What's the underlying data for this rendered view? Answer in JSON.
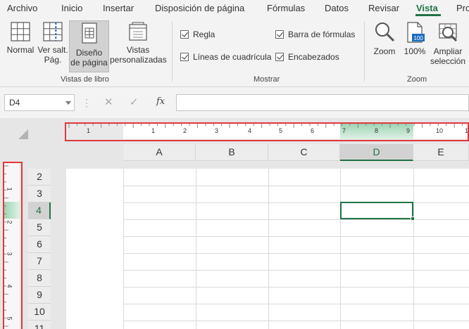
{
  "menu": {
    "tabs": [
      {
        "label": "Archivo"
      },
      {
        "label": "Inicio"
      },
      {
        "label": "Insertar"
      },
      {
        "label": "Disposición de página"
      },
      {
        "label": "Fórmulas"
      },
      {
        "label": "Datos"
      },
      {
        "label": "Revisar"
      },
      {
        "label": "Vista",
        "active": true
      },
      {
        "label": "Pro"
      }
    ]
  },
  "ribbon": {
    "workbook_views": {
      "group_label": "Vistas de libro",
      "buttons": [
        {
          "label_line1": "Normal",
          "label_line2": "",
          "icon": "normal-view-icon"
        },
        {
          "label_line1": "Ver salt.",
          "label_line2": "Pág.",
          "icon": "page-break-preview-icon"
        },
        {
          "label_line1": "Diseño",
          "label_line2": "de página",
          "icon": "page-layout-icon",
          "selected": true
        },
        {
          "label_line1": "Vistas",
          "label_line2": "personalizadas",
          "icon": "custom-views-icon"
        }
      ]
    },
    "show": {
      "group_label": "Mostrar",
      "checkboxes": [
        {
          "label": "Regla",
          "checked": true
        },
        {
          "label": "Líneas de cuadrícula",
          "checked": true
        },
        {
          "label": "Barra de fórmulas",
          "checked": true
        },
        {
          "label": "Encabezados",
          "checked": true
        }
      ]
    },
    "zoom": {
      "group_label": "Zoom",
      "buttons": [
        {
          "label_line1": "Zoom",
          "label_line2": "",
          "icon": "zoom-magnifier-icon"
        },
        {
          "label_line1": "100%",
          "label_line2": "",
          "icon": "zoom-100-icon",
          "icon_text": "100"
        },
        {
          "label_line1": "Ampliar",
          "label_line2": "selección",
          "icon": "zoom-to-selection-icon"
        }
      ]
    }
  },
  "formula_bar": {
    "name_box": "D4",
    "cancel_symbol": "✕",
    "enter_symbol": "✓",
    "fx_symbol": "fx",
    "value": ""
  },
  "ruler": {
    "horizontal_numbers": [
      "1",
      "1",
      "2",
      "3",
      "4",
      "5",
      "6",
      "7",
      "8",
      "9",
      "10",
      "1"
    ],
    "vertical_numbers": [
      "1",
      "2",
      "3",
      "4",
      "5"
    ]
  },
  "sheet": {
    "columns": [
      "A",
      "B",
      "C",
      "D",
      "E"
    ],
    "rows": [
      "2",
      "3",
      "4",
      "5",
      "6",
      "7",
      "8",
      "9",
      "10",
      "11"
    ],
    "selected_cell": "D4",
    "selected_column": "D",
    "selected_row": "4"
  },
  "colors": {
    "accent": "#217346",
    "highlight_box": "#e0383e",
    "ruler_highlight": "#9fd4b4"
  }
}
